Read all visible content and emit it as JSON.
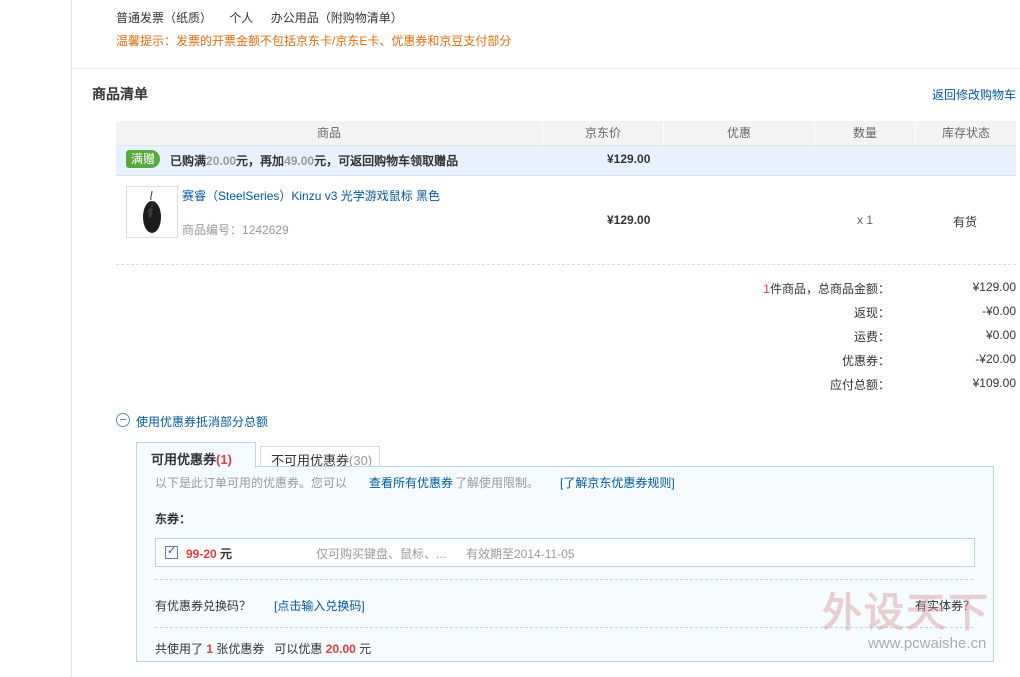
{
  "invoice": {
    "type": "普通发票（纸质）",
    "title": "个人",
    "content": "办公用品（附购物清单）",
    "tip": "温馨提示：发票的开票金额不包括京东卡/京东E卡、优惠券和京豆支付部分"
  },
  "section": {
    "title": "商品清单",
    "back_link": "返回修改购物车"
  },
  "table": {
    "headers": [
      "商品",
      "京东价",
      "优惠",
      "数量",
      "库存状态"
    ],
    "gift": {
      "badge": "满赠",
      "text_a": "已购满",
      "amount_a": "20.00",
      "text_b": "元，再加",
      "amount_b": "49.00",
      "text_c": "元，可返回购物车领取赠品",
      "price": "¥129.00"
    },
    "product": {
      "name": "赛睿（SteelSeries）Kinzu v3 光学游戏鼠标 黑色",
      "sku_label": "商品编号：",
      "sku": "1242629",
      "price": "¥129.00",
      "qty": "x 1",
      "stock": "有货"
    }
  },
  "summary": {
    "count": "1",
    "count_label": "件商品，总商品金额：",
    "total": "¥129.00",
    "cashback_label": "返现：",
    "cashback": "-¥0.00",
    "shipping_label": "运费：",
    "shipping": "¥0.00",
    "coupon_label": "优惠券：",
    "coupon": "-¥20.00",
    "payable_label": "应付总额：",
    "payable": "¥109.00"
  },
  "coupon": {
    "toggle_label": "使用优惠券抵消部分总额",
    "tab_available": "可用优惠券",
    "tab_available_count": "(1)",
    "tab_unavailable": "不可用优惠券",
    "tab_unavailable_count": "(30)",
    "info_text": "以下是此订单可用的优惠券。您可以",
    "view_all_link": "查看所有优惠券",
    "info_text2": "了解使用限制。",
    "rules_link": "[了解京东优惠券规则]",
    "dong_label": "东券：",
    "item": {
      "amount": "99-20",
      "unit": "元",
      "limit": "仅可购买键盘、鼠标、...",
      "expiry": "有效期至2014-11-05"
    },
    "redeem_label": "有优惠券兑换码？",
    "redeem_link": "[点击输入兑换码]",
    "physical_label": "有实体券？",
    "used_a": "共使用了",
    "used_count": "1",
    "used_b": "张优惠券",
    "save_a": "可以优惠",
    "save_amount": "20.00",
    "save_b": "元"
  },
  "watermark": {
    "text": "外设天下",
    "url": "www.pcwaishe.cn"
  },
  "colors": {
    "link": "#005aa0",
    "red": "#e4393c",
    "tip_orange": "#e56c0a",
    "gift_bg": "#e8f2ff",
    "badge_green": "#59a93f"
  }
}
